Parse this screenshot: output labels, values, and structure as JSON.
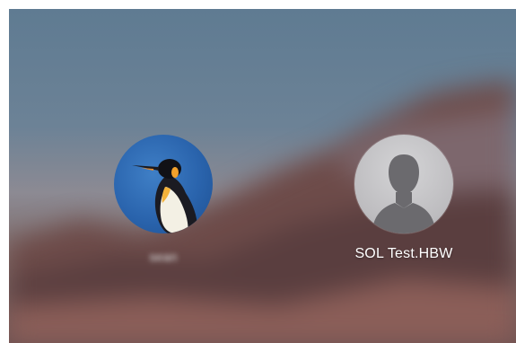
{
  "screen": {
    "title": "macOS login window"
  },
  "users": [
    {
      "name": "sean",
      "avatar_icon": "penguin-avatar-icon",
      "name_obscured": true
    },
    {
      "name": "SOL Test.HBW",
      "avatar_icon": "generic-user-silhouette-icon",
      "name_obscured": false
    }
  ],
  "colors": {
    "background_top": "#5f7b92",
    "background_bottom": "#6e5252",
    "avatar_generic": "#bdbcbf",
    "penguin_bg": "#2a64ad"
  }
}
